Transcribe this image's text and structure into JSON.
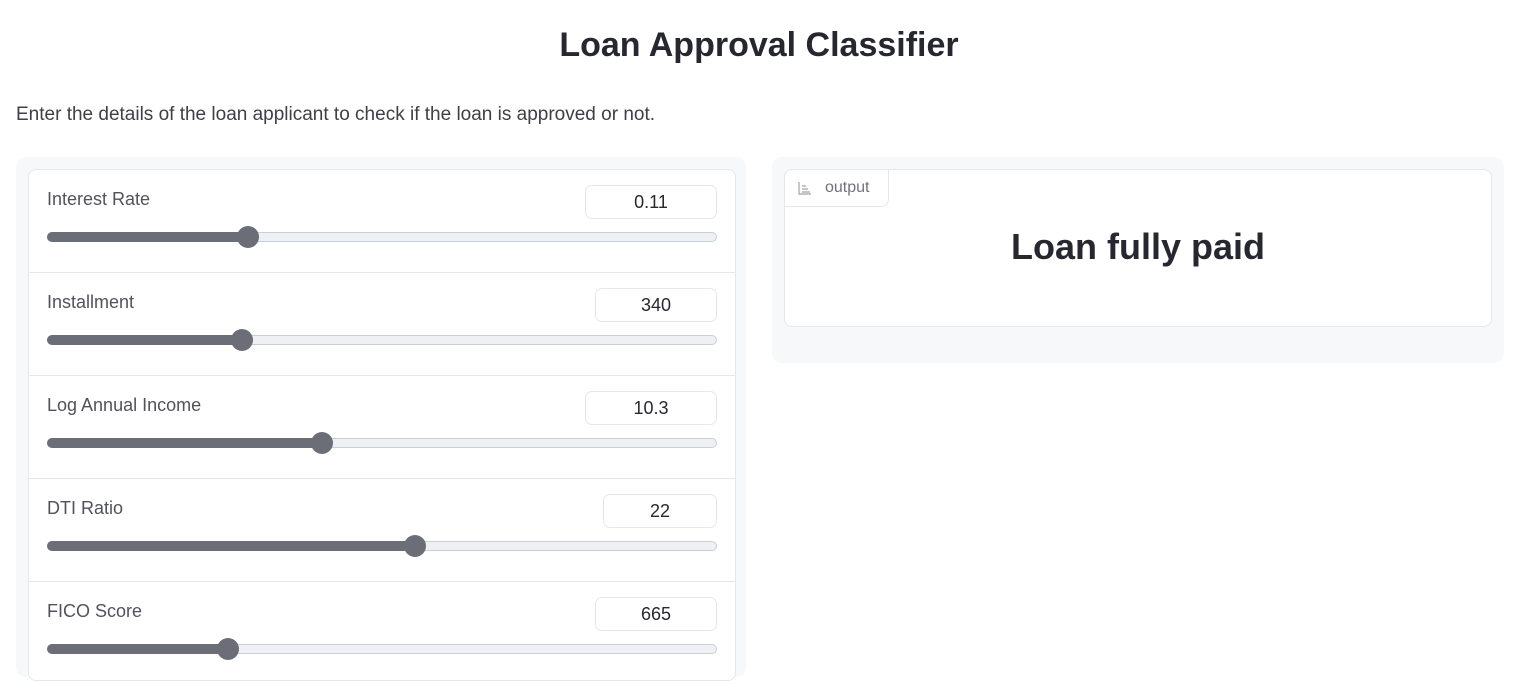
{
  "header": {
    "title": "Loan Approval Classifier",
    "description": "Enter the details of the loan applicant to check if the loan is approved or not."
  },
  "inputs": [
    {
      "label": "Interest Rate",
      "value": "0.11",
      "fraction": 0.3
    },
    {
      "label": "Installment",
      "value": "340",
      "fraction": 0.29
    },
    {
      "label": "Log Annual Income",
      "value": "10.3",
      "fraction": 0.41
    },
    {
      "label": "DTI Ratio",
      "value": "22",
      "fraction": 0.55
    },
    {
      "label": "FICO Score",
      "value": "665",
      "fraction": 0.27
    }
  ],
  "output": {
    "tag_label": "output",
    "tag_icon": "bar-chart-icon",
    "value": "Loan fully paid"
  },
  "colors": {
    "slider_fill": "#6b6e76",
    "slider_track": "#eef0f4",
    "panel_background": "#f7f8fa"
  }
}
